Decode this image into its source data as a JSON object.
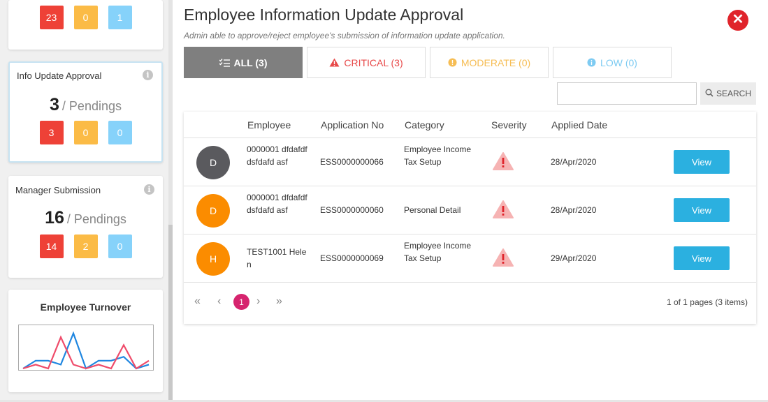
{
  "sidebar": {
    "top_card": {
      "counts": [
        "23",
        "0",
        "1"
      ]
    },
    "info_update": {
      "title": "Info Update Approval",
      "count": "3",
      "pending_label": "/ Pendings",
      "counts": [
        "3",
        "0",
        "0"
      ]
    },
    "manager_submission": {
      "title": "Manager Submission",
      "count": "16",
      "pending_label": "/ Pendings",
      "counts": [
        "14",
        "2",
        "0"
      ]
    },
    "turnover": {
      "title": "Employee Turnover",
      "chart_data": {
        "type": "line",
        "x": [
          1,
          2,
          3,
          4,
          5,
          6,
          7,
          8,
          9,
          10,
          11
        ],
        "series": [
          {
            "color": "#1f86e0",
            "values": [
              0,
              2,
              2,
              1,
              9,
              0,
              2,
              2,
              3,
              0,
              1
            ]
          },
          {
            "color": "#ef4b6a",
            "values": [
              0,
              1,
              0,
              8,
              1,
              0,
              1,
              0,
              6,
              0,
              2
            ]
          }
        ]
      }
    }
  },
  "header": {
    "title": "Employee Information Update Approval",
    "subtitle": "Admin able to approve/reject employee's submission of information update application.",
    "close_glyph": "✕"
  },
  "filters": [
    {
      "label": "ALL (3)",
      "icon": "list-icon"
    },
    {
      "label": "CRITICAL (3)",
      "icon": "warning-icon",
      "color": "#e84a4a"
    },
    {
      "label": "MODERATE (0)",
      "icon": "moderate-icon",
      "color": "#f6bd54"
    },
    {
      "label": "LOW (0)",
      "icon": "info-icon",
      "color": "#7ecbf2"
    }
  ],
  "search": {
    "placeholder": "",
    "button_label": "SEARCH"
  },
  "table": {
    "headers": [
      "Employee",
      "Application No",
      "Category",
      "Severity",
      "Applied Date"
    ],
    "rows": [
      {
        "initial": "D",
        "avatar_color": "#5a5a5e",
        "employee": "0000001 dfdafdfdsfdafd asf",
        "app_no": "ESS0000000066",
        "category": "Employee Income Tax Setup",
        "date": "28/Apr/2020",
        "view_label": "View"
      },
      {
        "initial": "D",
        "avatar_color": "#fb8c00",
        "employee": "0000001 dfdafdfdsfdafd asf",
        "app_no": "ESS0000000060",
        "category": "Personal Detail",
        "date": "28/Apr/2020",
        "view_label": "View"
      },
      {
        "initial": "H",
        "avatar_color": "#fb8c00",
        "employee": "TEST1001 Helen",
        "app_no": "ESS0000000069",
        "category": "Employee Income Tax Setup",
        "date": "29/Apr/2020",
        "view_label": "View"
      }
    ]
  },
  "pagination": {
    "first": "«",
    "prev": "‹",
    "current": "1",
    "next": "›",
    "last": "»",
    "info": "1 of 1 pages (3 items)"
  }
}
